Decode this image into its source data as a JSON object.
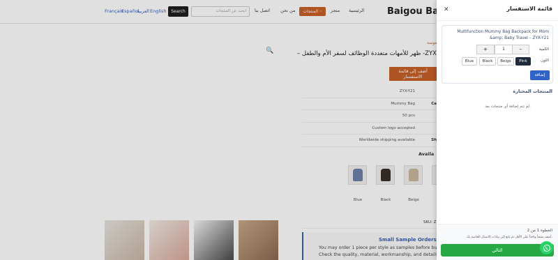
{
  "header": {
    "logo": "Baigou Bag Fa",
    "nav": {
      "home": "الرئيسية",
      "shop": "متجر",
      "products": "المنتجات ◦",
      "about": "من نحن",
      "contact": "اتصل بنا"
    },
    "search_placeholder": "ابحث عن المنتجات",
    "search_button": "Search",
    "languages": [
      "English",
      "العربية",
      "Español",
      "Français"
    ]
  },
  "product": {
    "breadcrumb": "موسة",
    "title": "ZYX- ظهر للأمهات متعددة الوظائف لسفر الأم والطفل –",
    "add_to_enquiry": "أضف إلى قائمة الاستفسار",
    "specs": [
      {
        "key": "",
        "value": "ZYX-Y21"
      },
      {
        "key": "Ca",
        "value": "Mummy Bag"
      },
      {
        "key": "",
        "value": "50 pcs"
      },
      {
        "key": "",
        "value": "Custom logo accepted"
      },
      {
        "key": "Sh",
        "value": "Worldwide shipping available"
      }
    ],
    "available_label": "Availa",
    "color_swatches": [
      {
        "label": "Blue",
        "color": "#6b83a8"
      },
      {
        "label": "Black",
        "color": "#3a2e2a"
      },
      {
        "label": "Beige",
        "color": "#c9b89c"
      }
    ],
    "sku_label": "SKU: Z",
    "sample": {
      "title": "Small Sample Orders Avail",
      "line1": "You may order 1 piece per style as samples before bulk produ",
      "line2": "Check the quality, material, workmanship, and details first before"
    }
  },
  "drawer": {
    "title": "قائمة الاستفسار",
    "item": {
      "name": "Multifunction Mummy Bag Backpack for Mom &amp; Baby Travel – ZYX-Y21",
      "qty_label": "الكمية",
      "qty_value": "1",
      "minus": "–",
      "plus": "+",
      "color_label": "اللون",
      "colors": [
        "Pink",
        "Beige",
        "Black",
        "Blue"
      ],
      "selected_color": "Pink",
      "add_button": "إضافة"
    },
    "selected_title": "المنتجات المختارة",
    "empty_message": "لم تتم إضافة أي منتجات بعد.",
    "footer": {
      "step": "الخطوة 1 من 2",
      "hint": "أضف منتجاً واحداً على الأقل ثم تابع إلى بيانات الاتصال الخاصة بك.",
      "next_button": "التالي"
    }
  }
}
